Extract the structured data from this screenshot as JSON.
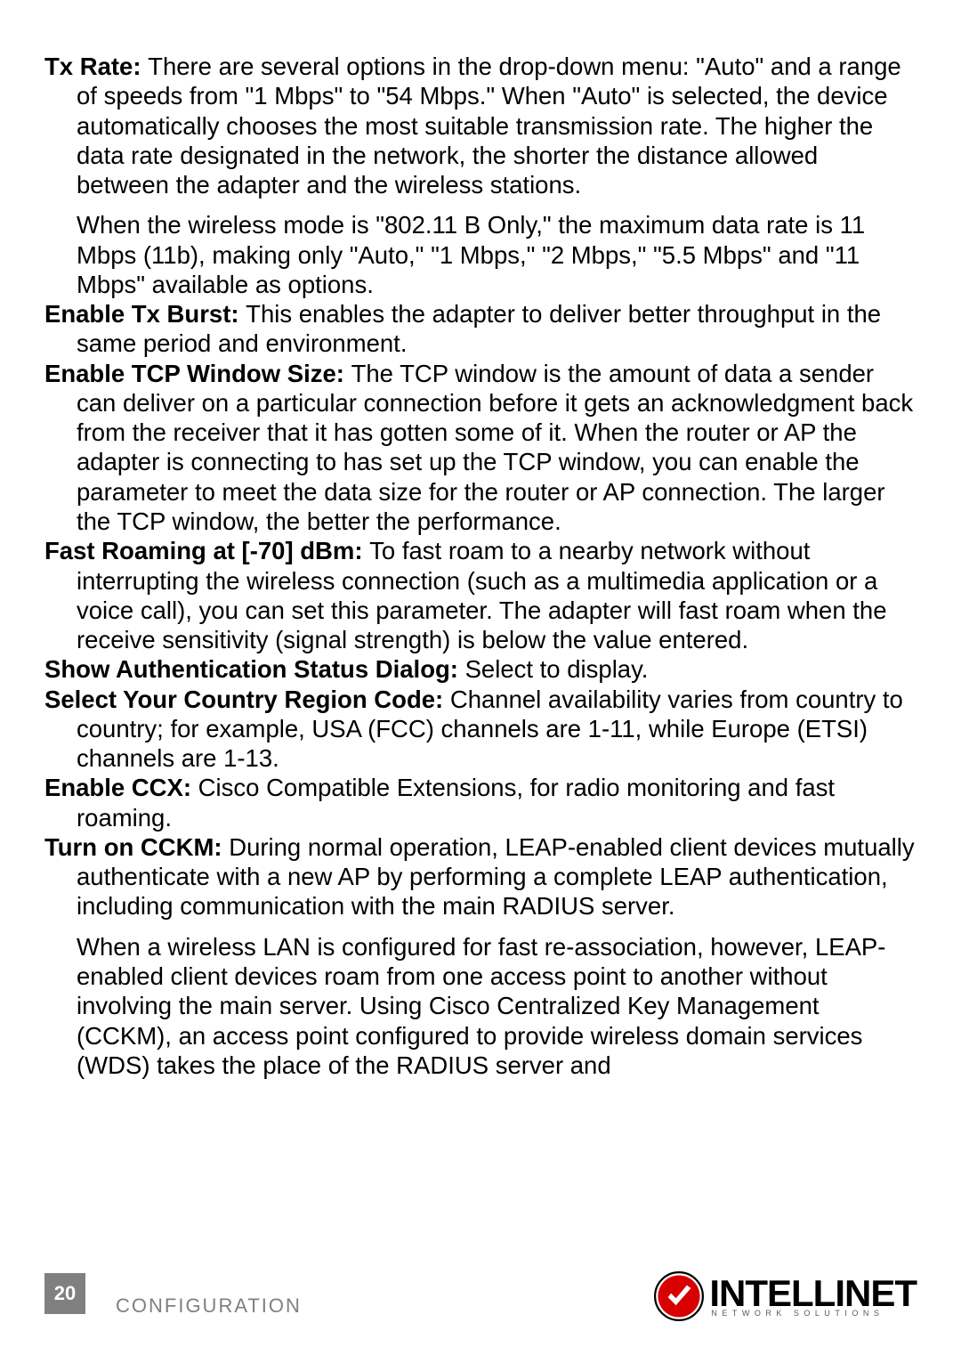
{
  "entries": [
    {
      "term": "Tx Rate: ",
      "body": "There are several options in the drop-down menu: \"Auto\" and a range of speeds from \"1 Mbps\" to \"54 Mbps.\" When \"Auto\" is selected, the device automatically chooses the most suitable transmission rate. The higher the data rate designated in the network, the shorter the distance allowed between the adapter and the wireless stations.",
      "cont": "When the wireless mode is \"802.11 B Only,\" the maximum data rate is 11 Mbps (11b), making only \"Auto,\" \"1 Mbps,\" \"2 Mbps,\" \"5.5 Mbps\" and \"11 Mbps\" available as options."
    },
    {
      "term": "Enable Tx Burst: ",
      "body": "This enables the adapter to deliver better throughput in the same period and environment."
    },
    {
      "term": "Enable TCP Window Size: ",
      "body": "The TCP window is the amount of data a sender can deliver on a particular connection before it gets an acknowledgment back from the receiver that it has gotten some of it. When the router or AP the adapter is connecting to has set up the TCP window, you can enable the parameter to meet the data size for the router or AP connection. The larger the TCP window, the better the performance."
    },
    {
      "term": "Fast Roaming at [-70] dBm: ",
      "body": "To fast roam to a nearby network without interrupting the wireless connection (such as a multimedia application or a voice call), you can set this parameter. The adapter will fast roam when the receive sensitivity (signal strength) is below the value entered."
    },
    {
      "term": "Show Authentication Status Dialog: ",
      "body": "Select to display."
    },
    {
      "term": "Select Your Country Region Code: ",
      "body": "Channel availability varies from country to country; for example, USA (FCC) channels are 1-11, while Europe (ETSI) channels are 1-13."
    },
    {
      "term": "Enable CCX: ",
      "body": "Cisco Compatible Extensions, for radio monitoring and fast roaming."
    },
    {
      "term": "Turn on CCKM: ",
      "body": "During normal operation, LEAP-enabled client devices mutually authenticate with a new AP by performing a complete LEAP authentication, including communication with the main RADIUS server.",
      "cont": "When a wireless LAN is configured for fast re-association, however, LEAP-enabled client devices roam from one access point to another without involving the main server. Using Cisco Centralized Key Management (CCKM), an access point configured to provide wireless domain services (WDS) takes the place of the RADIUS server and"
    }
  ],
  "footer": {
    "page_number": "20",
    "section": "CONFIGURATION",
    "brand": "INTELLINET",
    "brand_sub": "NETWORK SOLUTIONS"
  }
}
